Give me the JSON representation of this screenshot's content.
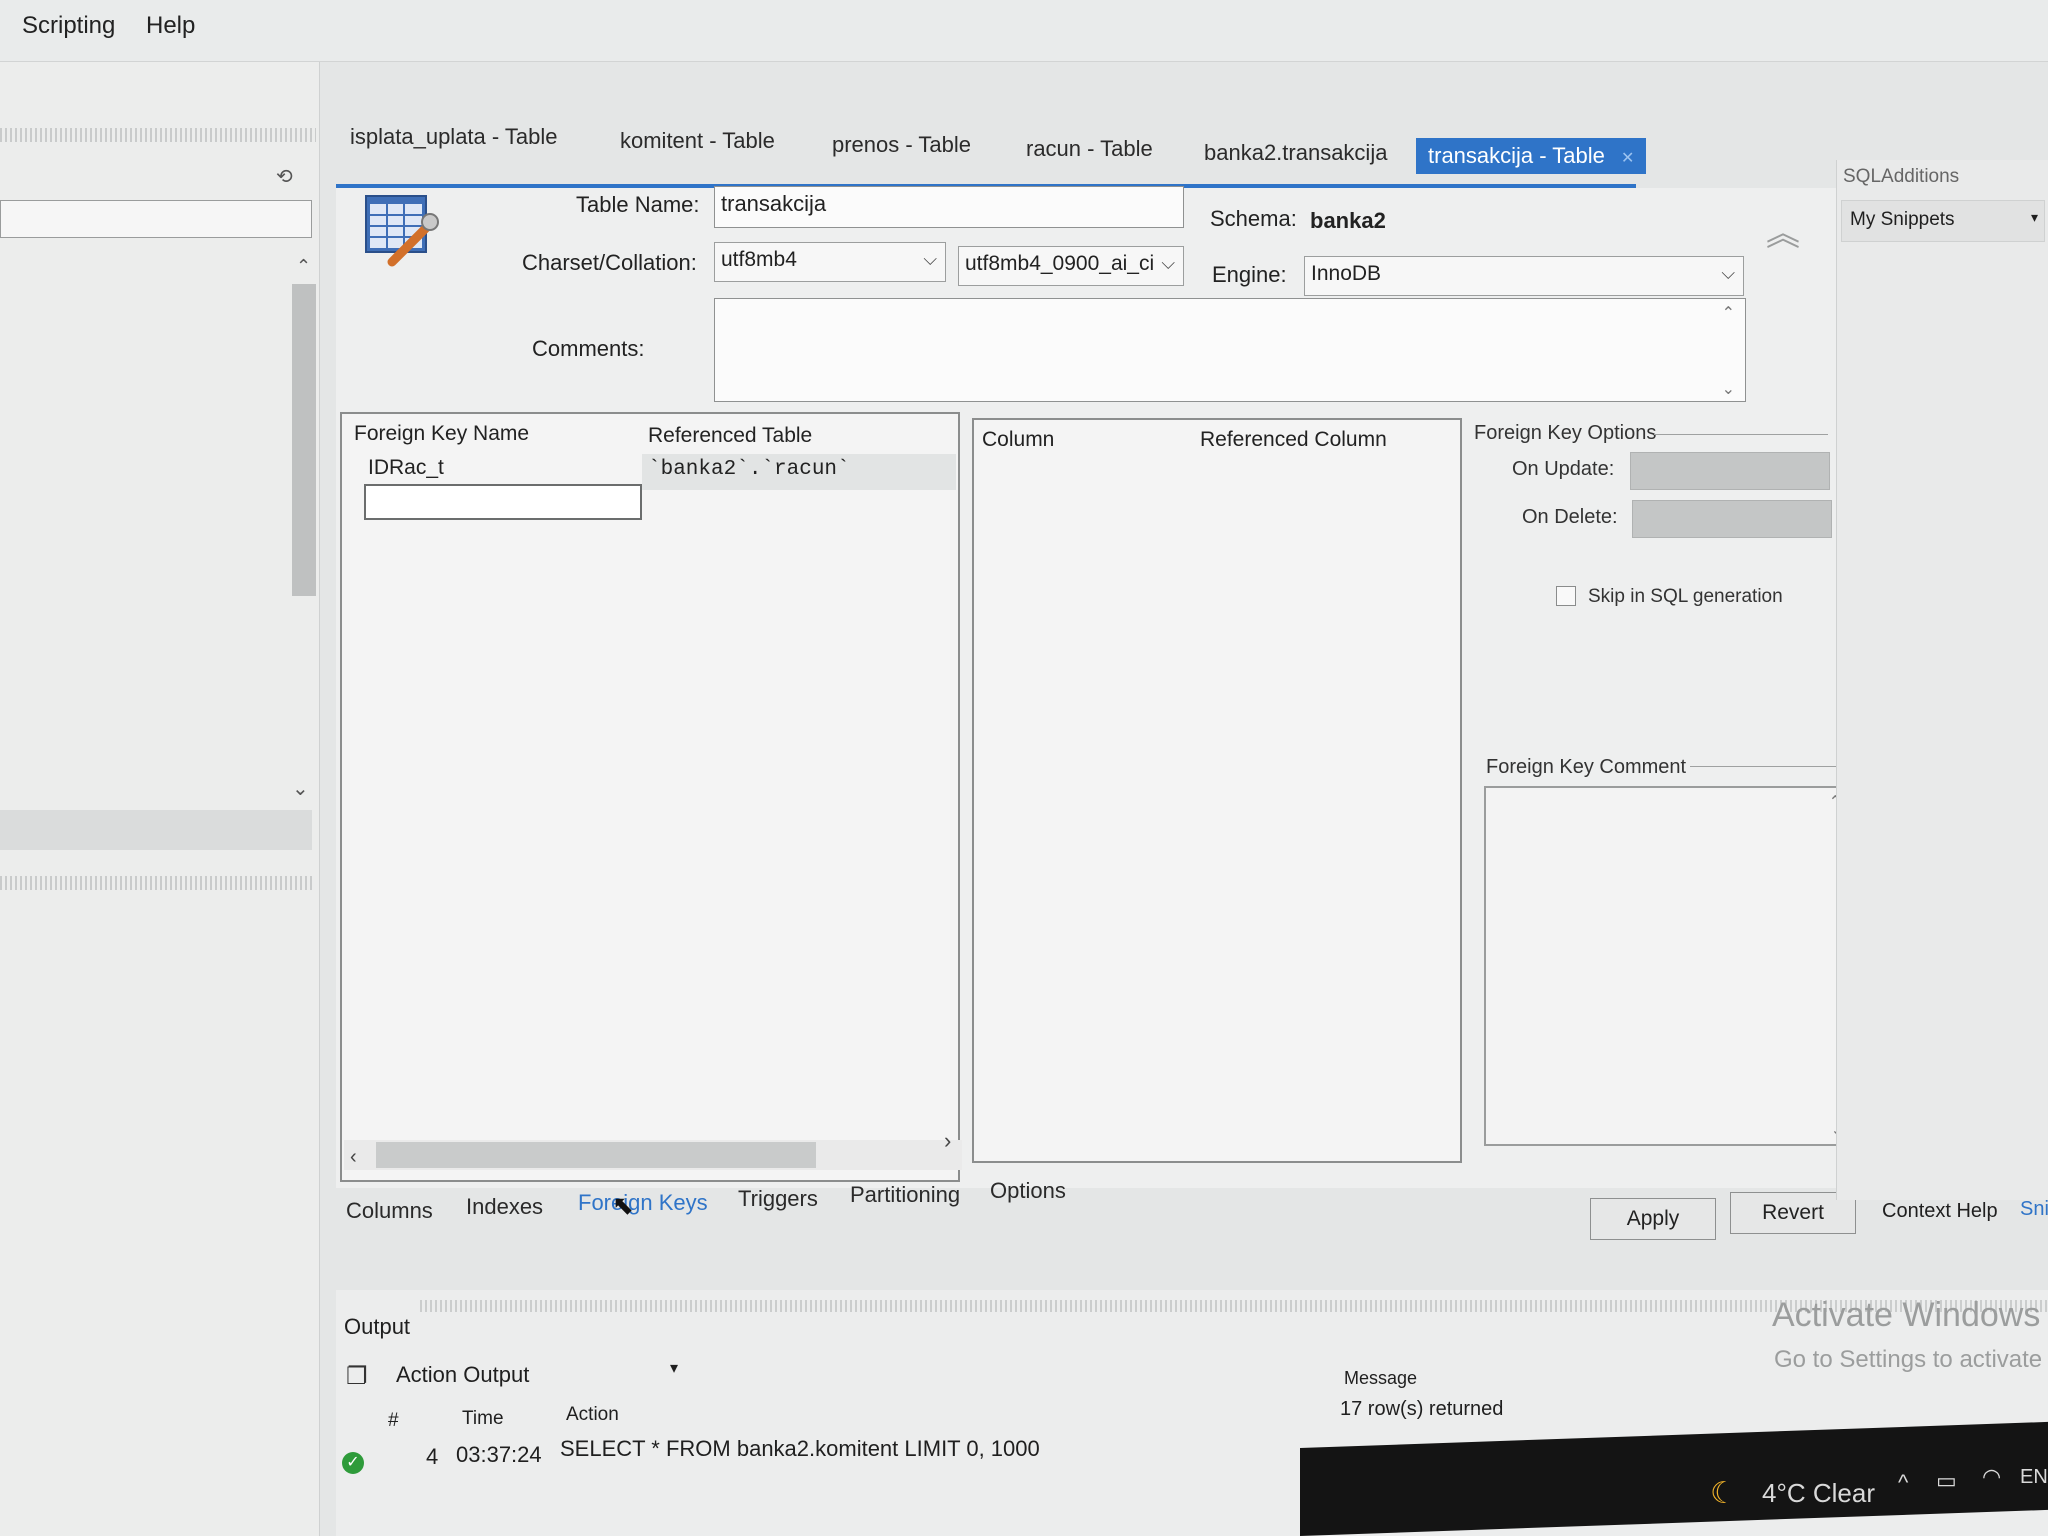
{
  "menu": {
    "items": [
      "Scripting",
      "Help"
    ]
  },
  "doc_tabs": [
    {
      "label": "isplata_uplata - Table"
    },
    {
      "label": "komitent - Table"
    },
    {
      "label": "prenos - Table"
    },
    {
      "label": "racun - Table"
    },
    {
      "label": "banka2.transakcija"
    },
    {
      "label": "transakcija - Table",
      "active": true
    }
  ],
  "table_editor": {
    "table_name_label": "Table Name:",
    "table_name_value": "transakcija",
    "schema_label": "Schema:",
    "schema_value": "banka2",
    "charset_label": "Charset/Collation:",
    "charset_value": "utf8mb4",
    "collation_value": "utf8mb4_0900_ai_ci",
    "engine_label": "Engine:",
    "engine_value": "InnoDB",
    "comments_label": "Comments:"
  },
  "fk_grid": {
    "headers": [
      "Foreign Key Name",
      "Referenced Table"
    ],
    "rows": [
      {
        "name": "IDRac_t",
        "ref_table": "`banka2`.`racun`"
      }
    ]
  },
  "column_grid": {
    "headers": [
      "Column",
      "Referenced Column"
    ]
  },
  "fk_options": {
    "title": "Foreign Key Options",
    "on_update_label": "On Update:",
    "on_delete_label": "On Delete:",
    "skip_label": "Skip in SQL generation",
    "comment_title": "Foreign Key Comment"
  },
  "sub_tabs": [
    "Columns",
    "Indexes",
    "Foreign Keys",
    "Triggers",
    "Partitioning",
    "Options"
  ],
  "active_sub_tab": "Foreign Keys",
  "buttons": {
    "apply": "Apply",
    "revert": "Revert"
  },
  "right_panel": {
    "title": "SQLAdditions",
    "snippets": "My Snippets",
    "context_help": "Context Help",
    "snippets_tab": "Sni"
  },
  "output": {
    "title": "Output",
    "selector": "Action Output",
    "headers": {
      "num": "#",
      "time": "Time",
      "action": "Action",
      "message": "Message"
    },
    "rows": [
      {
        "num": "4",
        "time": "03:37:24",
        "action": "SELECT * FROM banka2.komitent LIMIT 0, 1000",
        "message": "17 row(s) returned"
      }
    ]
  },
  "watermark": {
    "line1": "Activate Windows",
    "line2": "Go to Settings to activate"
  },
  "taskbar": {
    "weather": "4°C  Clear",
    "lang": "EN"
  },
  "colors": {
    "accent": "#2f74c8",
    "success": "#2e9b3a"
  }
}
